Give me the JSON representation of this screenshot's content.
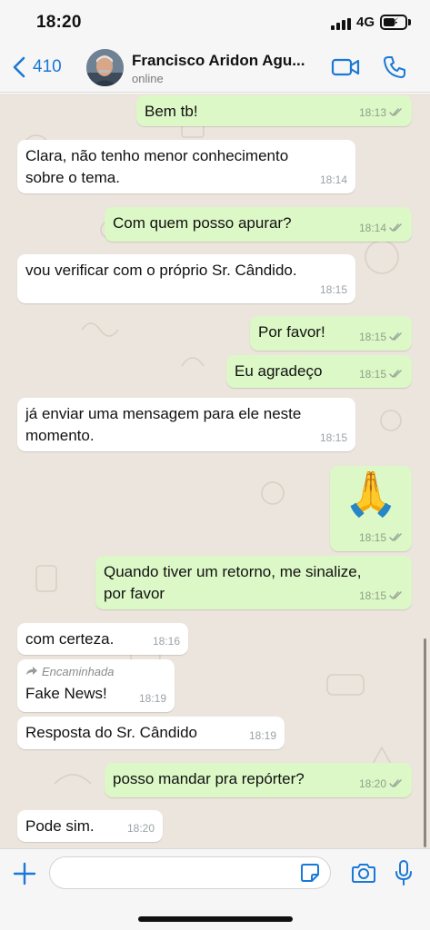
{
  "status_bar": {
    "time": "18:20",
    "network": "4G"
  },
  "header": {
    "back_count": "410",
    "contact_name": "Francisco Aridon Agu...",
    "contact_status": "online"
  },
  "colors": {
    "accent": "#1a78d6",
    "incoming_bubble": "#ffffff",
    "outgoing_bubble": "#dcf8c6",
    "chat_background": "#ece5dd"
  },
  "messages": [
    {
      "dir": "out",
      "text": "Bem tb!",
      "time": "18:13",
      "read": true
    },
    {
      "dir": "in",
      "text": "Clara, não tenho menor conhecimento\nsobre o tema.",
      "time": "18:14"
    },
    {
      "dir": "out",
      "text": "Com quem posso apurar?",
      "time": "18:14",
      "read": true
    },
    {
      "dir": "in",
      "text": "vou verificar com o próprio Sr. Cândido.",
      "time": "18:15"
    },
    {
      "dir": "out",
      "text": "Por favor!",
      "time": "18:15",
      "read": true
    },
    {
      "dir": "out",
      "text": "Eu agradeço",
      "time": "18:15",
      "read": true
    },
    {
      "dir": "in",
      "text": "já enviar uma mensagem para ele neste\nmomento.",
      "time": "18:15"
    },
    {
      "dir": "out",
      "text": "🙏",
      "time": "18:15",
      "read": true,
      "emoji": true
    },
    {
      "dir": "out",
      "text": "Quando tiver um retorno, me sinalize,\npor favor",
      "time": "18:15",
      "read": true
    },
    {
      "dir": "in",
      "text": "com certeza.",
      "time": "18:16"
    },
    {
      "dir": "in",
      "forwarded_label": "Encaminhada",
      "text": "Fake News!",
      "time": "18:19"
    },
    {
      "dir": "in",
      "text": "Resposta do Sr. Cândido",
      "time": "18:19"
    },
    {
      "dir": "out",
      "text": "posso mandar pra repórter?",
      "time": "18:20",
      "read": true
    },
    {
      "dir": "in",
      "text": "Pode sim.",
      "time": "18:20"
    }
  ],
  "input": {
    "value": "",
    "placeholder": ""
  },
  "icons": {
    "back": "chevron-left-icon",
    "video": "video-camera-icon",
    "phone": "phone-icon",
    "plus": "plus-icon",
    "sticker": "sticker-icon",
    "camera": "camera-icon",
    "mic": "microphone-icon",
    "forward": "forward-arrow-icon",
    "read_receipt": "double-check-icon"
  }
}
